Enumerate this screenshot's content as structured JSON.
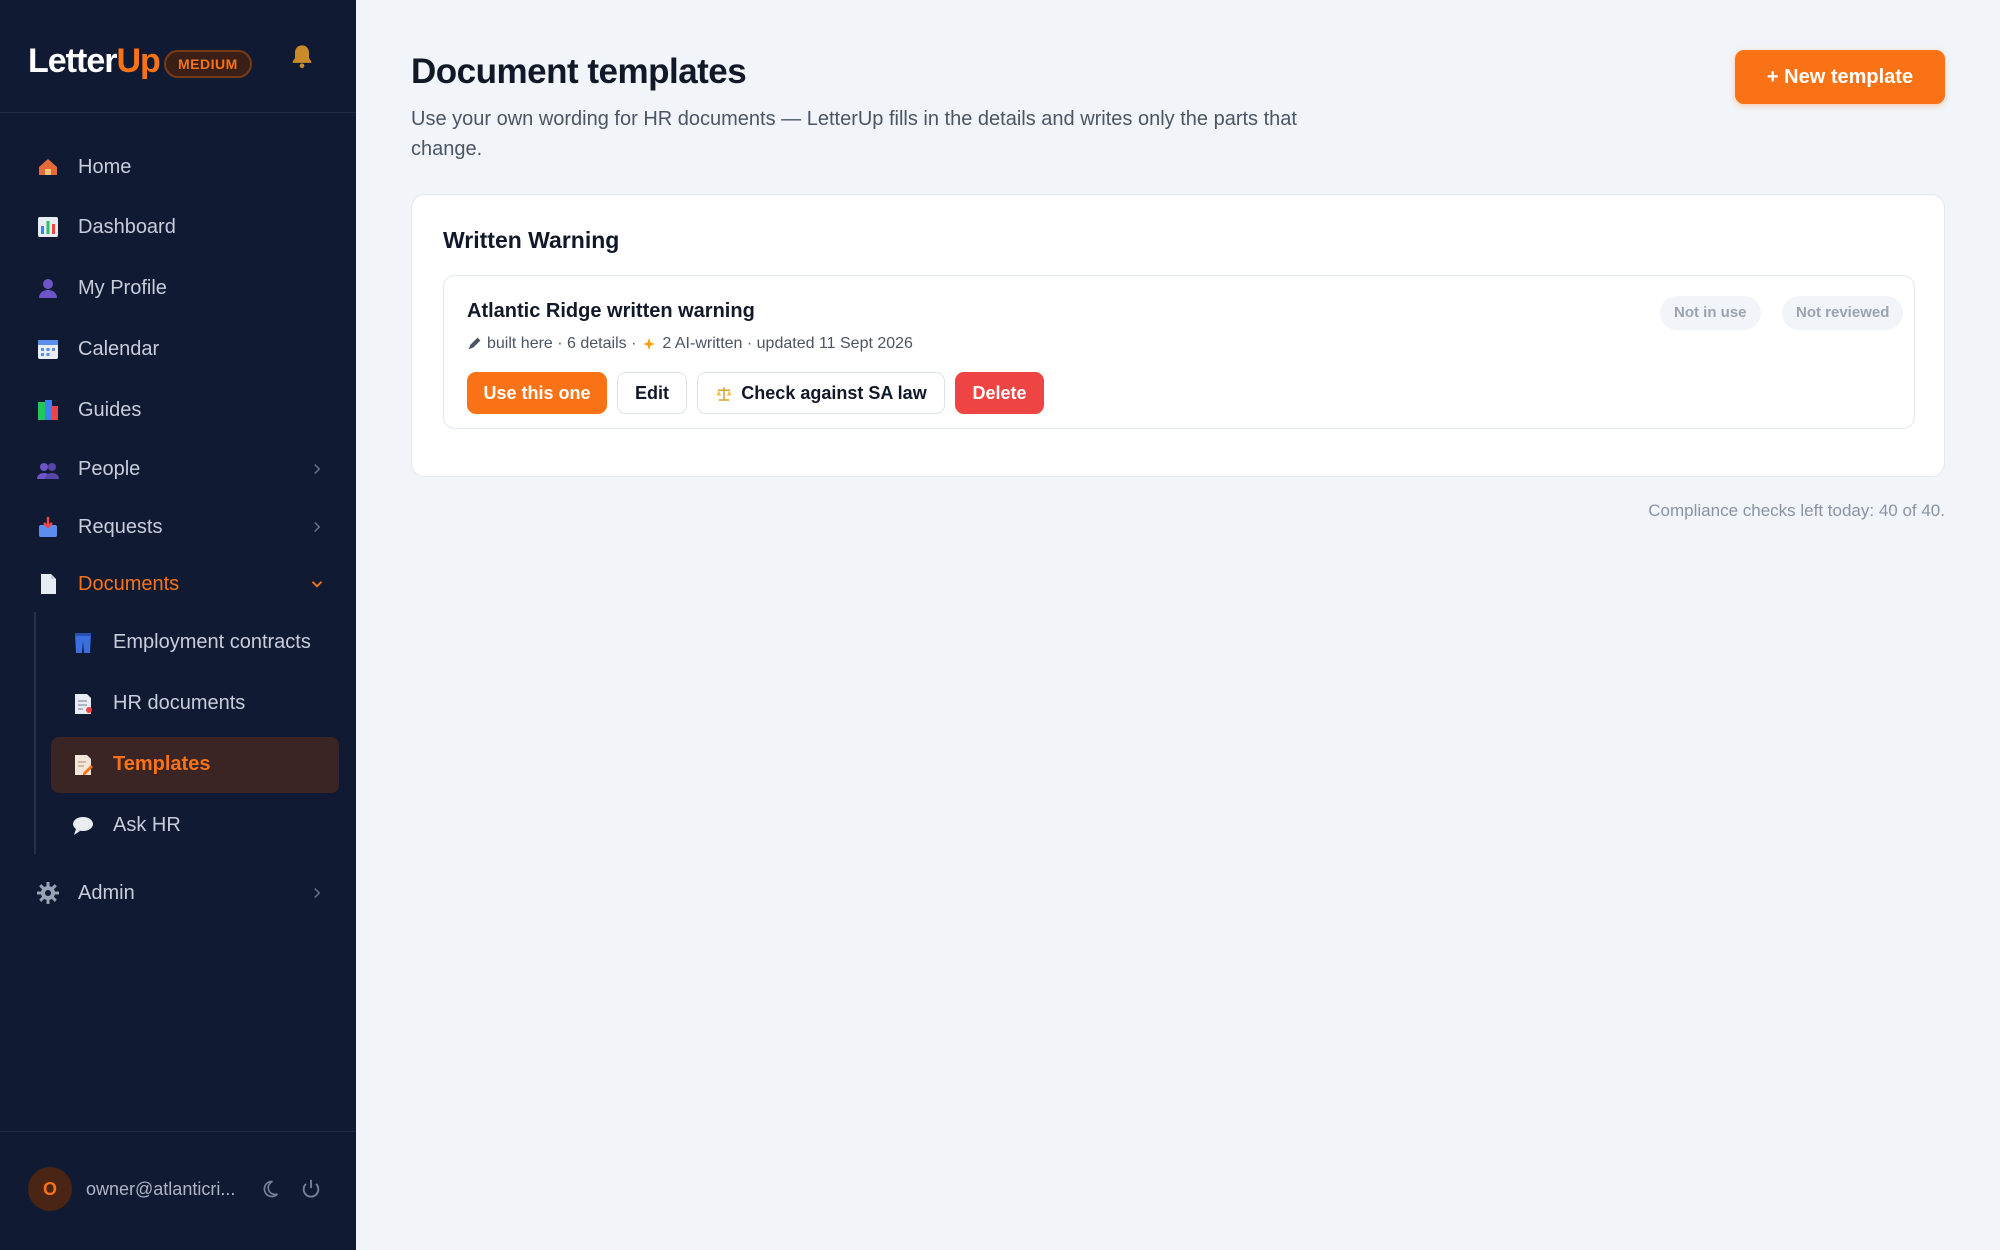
{
  "brand": {
    "name_part1": "Letter",
    "name_part2": "Up",
    "plan": "MEDIUM"
  },
  "nav": {
    "items": [
      {
        "label": "Home",
        "icon": "house-icon"
      },
      {
        "label": "Dashboard",
        "icon": "bar-chart-icon"
      },
      {
        "label": "My Profile",
        "icon": "person-icon"
      },
      {
        "label": "Calendar",
        "icon": "calendar-icon"
      },
      {
        "label": "Guides",
        "icon": "books-icon"
      },
      {
        "label": "People",
        "icon": "people-icon"
      },
      {
        "label": "Requests",
        "icon": "inbox-icon"
      },
      {
        "label": "Documents",
        "icon": "page-icon"
      },
      {
        "label": "Admin",
        "icon": "gear-icon"
      }
    ],
    "documents_sub": [
      {
        "label": "Employment contracts",
        "icon": "jeans-icon"
      },
      {
        "label": "HR documents",
        "icon": "document-icon"
      },
      {
        "label": "Templates",
        "icon": "memo-icon"
      },
      {
        "label": "Ask HR",
        "icon": "speech-bubble-icon"
      }
    ]
  },
  "user": {
    "initial": "O",
    "email": "owner@atlanticri..."
  },
  "header": {
    "title": "Document templates",
    "description": "Use your own wording for HR documents — LetterUp fills in the details and writes only the parts that change.",
    "new_button": "+ New template"
  },
  "section": {
    "title": "Written Warning",
    "templates": [
      {
        "name": "Atlantic Ridge written warning",
        "meta_built": "built here · 6 details ·",
        "meta_ai": "2 AI-written · updated 11 Sept 2026",
        "status_usage": "Not in use",
        "status_review": "Not reviewed",
        "actions": {
          "use": "Use this one",
          "edit": "Edit",
          "check": "Check against SA law",
          "delete": "Delete"
        }
      }
    ]
  },
  "footer": {
    "compliance": "Compliance checks left today: 40 of 40."
  },
  "colors": {
    "accent": "#f97316",
    "sidebar": "#111a33",
    "danger": "#ef4444",
    "background": "#f1f4f8"
  }
}
